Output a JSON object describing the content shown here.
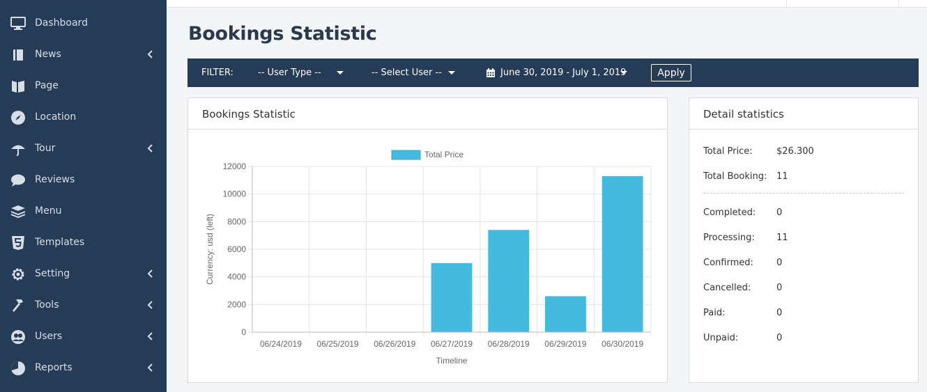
{
  "sidebar": {
    "items": [
      {
        "label": "Dashboard",
        "icon": "monitor-icon",
        "has_submenu": false
      },
      {
        "label": "News",
        "icon": "book-icon",
        "has_submenu": true
      },
      {
        "label": "Page",
        "icon": "page-icon",
        "has_submenu": false
      },
      {
        "label": "Location",
        "icon": "compass-icon",
        "has_submenu": false
      },
      {
        "label": "Tour",
        "icon": "umbrella-icon",
        "has_submenu": true
      },
      {
        "label": "Reviews",
        "icon": "comment-icon",
        "has_submenu": false
      },
      {
        "label": "Menu",
        "icon": "layers-icon",
        "has_submenu": false
      },
      {
        "label": "Templates",
        "icon": "html5-icon",
        "has_submenu": false
      },
      {
        "label": "Setting",
        "icon": "gear-icon",
        "has_submenu": true
      },
      {
        "label": "Tools",
        "icon": "hammer-icon",
        "has_submenu": true
      },
      {
        "label": "Users",
        "icon": "users-icon",
        "has_submenu": true
      },
      {
        "label": "Reports",
        "icon": "pie-chart-icon",
        "has_submenu": true
      }
    ]
  },
  "page": {
    "title": "Bookings Statistic"
  },
  "filter": {
    "label": "FILTER:",
    "user_type": "-- User Type --",
    "select_user": "-- Select User --",
    "date_range": "June 30, 2019 - July 1, 2019",
    "apply_label": "Apply"
  },
  "chart_card": {
    "title": "Bookings Statistic"
  },
  "chart_data": {
    "type": "bar",
    "categories": [
      "06/24/2019",
      "06/25/2019",
      "06/26/2019",
      "06/27/2019",
      "06/28/2019",
      "06/29/2019",
      "06/30/2019"
    ],
    "series": [
      {
        "name": "Total Price",
        "values": [
          0,
          0,
          0,
          5000,
          7400,
          2600,
          11300
        ]
      }
    ],
    "ylim": [
      0,
      12000
    ],
    "yticks": [
      0,
      2000,
      4000,
      6000,
      8000,
      10000,
      12000
    ],
    "xlabel": "Timeline",
    "ylabel": "Currency: usd (left)",
    "legend_position": "top-center",
    "grid": true,
    "bar_color": "#46b9df"
  },
  "detail": {
    "title": "Detail statistics",
    "summary": [
      {
        "label": "Total Price:",
        "value": "$26.300"
      },
      {
        "label": "Total Booking:",
        "value": "11"
      }
    ],
    "statuses": [
      {
        "label": "Completed:",
        "value": "0"
      },
      {
        "label": "Processing:",
        "value": "11"
      },
      {
        "label": "Confirmed:",
        "value": "0"
      },
      {
        "label": "Cancelled:",
        "value": "0"
      },
      {
        "label": "Paid:",
        "value": "0"
      },
      {
        "label": "Unpaid:",
        "value": "0"
      }
    ]
  },
  "colors": {
    "sidebar_bg": "#263b56",
    "filter_bg": "#263b56",
    "bar": "#46b9df",
    "page_bg": "#f4f5f7"
  }
}
